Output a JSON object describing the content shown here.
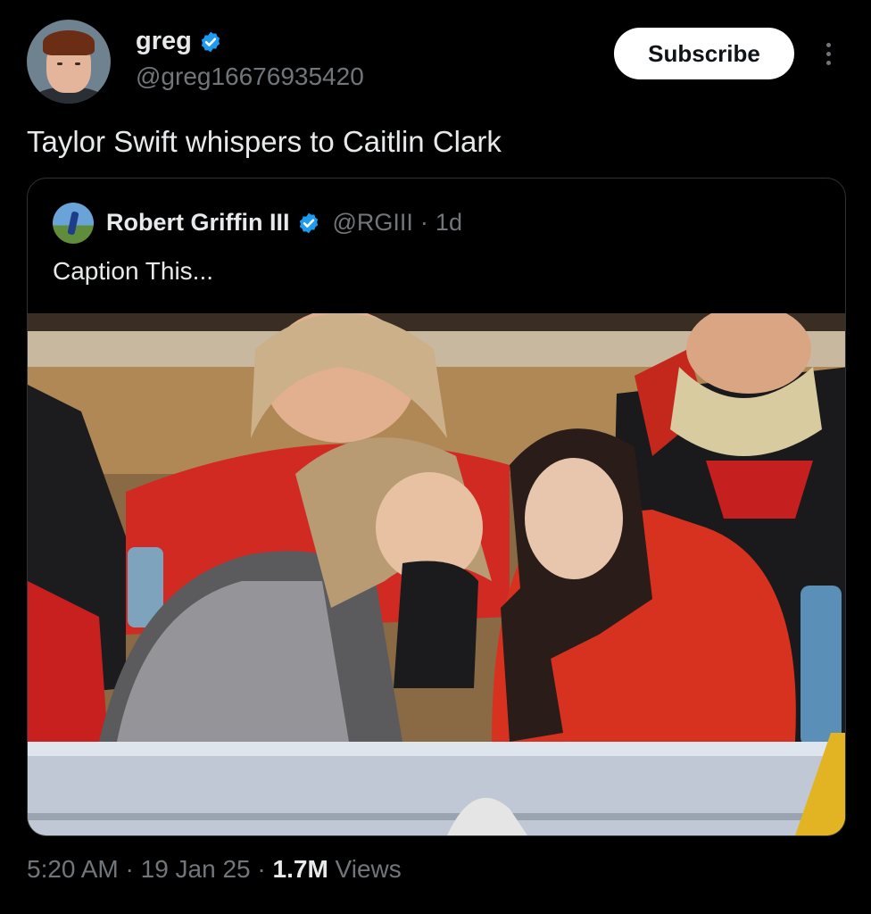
{
  "author": {
    "display_name": "greg",
    "handle": "@greg16676935420",
    "verified_icon": "verified-badge-icon",
    "avatar_icon": "avatar-photo"
  },
  "header": {
    "subscribe_label": "Subscribe",
    "more_icon": "more-vertical-icon"
  },
  "tweet": {
    "text": "Taylor Swift whispers to Caitlin Clark"
  },
  "quoted": {
    "display_name": "Robert Griffin III",
    "handle": "@RGIII",
    "separator": "·",
    "age": "1d",
    "text": "Caption This..."
  },
  "footer": {
    "time": "5:20 AM",
    "sep1": "·",
    "date": "19 Jan 25",
    "sep2": "·",
    "views_count": "1.7M",
    "views_label": "Views"
  },
  "colors": {
    "background": "#000000",
    "text": "#e7e9ea",
    "muted": "#71767b",
    "verified": "#1d9bf0",
    "border": "#2f3336"
  }
}
